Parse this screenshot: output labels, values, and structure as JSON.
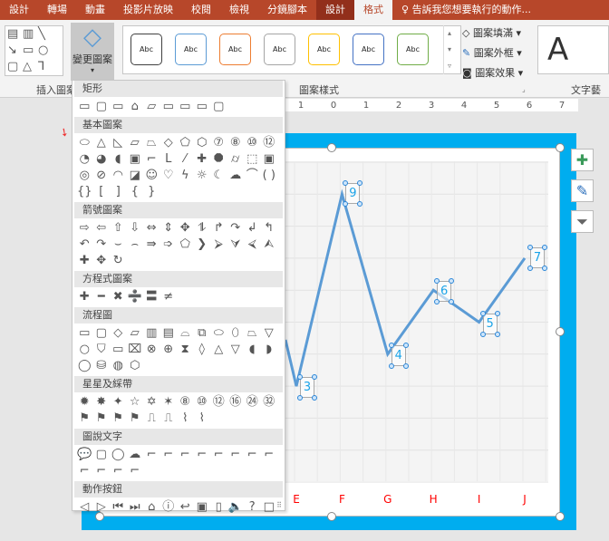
{
  "tabs": [
    "設計",
    "轉場",
    "動畫",
    "投影片放映",
    "校閱",
    "檢視",
    "分鏡腳本",
    "設計",
    "格式"
  ],
  "active_tab": "格式",
  "tell_me": "告訴我您想要執行的動作...",
  "ribbon": {
    "insert_shapes_label": "插入圖案",
    "insert_icons": [
      "▤",
      "▥",
      "╲",
      "↘",
      "▭",
      "○",
      "▢",
      "△",
      "⅂",
      "▾",
      "▿"
    ],
    "change_shape_label": "變更圖案",
    "styles_label": "圖案樣式",
    "gallery": [
      {
        "text": "Abc",
        "color": "#404040"
      },
      {
        "text": "Abc",
        "color": "#5b9bd5"
      },
      {
        "text": "Abc",
        "color": "#ed7d31"
      },
      {
        "text": "Abc",
        "color": "#a5a5a5"
      },
      {
        "text": "Abc",
        "color": "#ffc000"
      },
      {
        "text": "Abc",
        "color": "#4472c4"
      },
      {
        "text": "Abc",
        "color": "#70ad47"
      }
    ],
    "shape_fill": "圖案填滿",
    "shape_outline": "圖案外框",
    "shape_effects": "圖案效果",
    "wordart_label": "文字藝",
    "wordart_sample": "A"
  },
  "ruler": [
    "1",
    "0",
    "1",
    "2",
    "3",
    "4",
    "5",
    "6",
    "7"
  ],
  "dropdown": {
    "sections": [
      {
        "title": "矩形",
        "icons": [
          "▭",
          "▢",
          "▭",
          "⌂",
          "▱",
          "▭",
          "▭",
          "▭",
          "▢"
        ]
      },
      {
        "title": "基本圖案",
        "icons": [
          "⬭",
          "△",
          "◺",
          "▱",
          "⏢",
          "◇",
          "⬠",
          "⬡",
          "⑦",
          "⑧",
          "⑩",
          "⑫",
          "◔",
          "◕",
          "◖",
          "▣",
          "⌐",
          "L",
          "⁄",
          "✚",
          "⯃",
          "⌭",
          "⬚",
          "▣",
          "◎",
          "⊘",
          "◠",
          "◪",
          "☺",
          "♡",
          "ϟ",
          "☼",
          "☾",
          "☁",
          "⌒",
          "( )",
          "{}",
          "[",
          "]",
          "{",
          "}"
        ]
      },
      {
        "title": "箭號圖案",
        "icons": [
          "⇨",
          "⇦",
          "⇧",
          "⇩",
          "⇔",
          "⇕",
          "✥",
          "⥮",
          "↱",
          "↷",
          "↲",
          "↰",
          "↶",
          "↷",
          "⌣",
          "⌢",
          "⇛",
          "➩",
          "⬠",
          "❯",
          "⮚",
          "⮛",
          "⮘",
          "⮙",
          "✚",
          "✥",
          "↻"
        ]
      },
      {
        "title": "方程式圖案",
        "icons": [
          "✚",
          "━",
          "✖",
          "➗",
          "〓",
          "≠"
        ]
      },
      {
        "title": "流程圖",
        "icons": [
          "▭",
          "▢",
          "◇",
          "▱",
          "▥",
          "▤",
          "⌓",
          "⧉",
          "⬭",
          "⬯",
          "⏢",
          "▽",
          "○",
          "⛉",
          "▭",
          "⌧",
          "⊗",
          "⊕",
          "⧗",
          "◊",
          "△",
          "▽",
          "◖",
          "◗",
          "◯",
          "⛁",
          "◍",
          "⬡"
        ]
      },
      {
        "title": "星星及綵帶",
        "icons": [
          "✹",
          "✸",
          "✦",
          "☆",
          "✡",
          "✶",
          "⑧",
          "⑩",
          "⑫",
          "⑯",
          "㉔",
          "㉜",
          "⚑",
          "⚑",
          "⚑",
          "⚑",
          "⎍",
          "⎍",
          "⌇",
          "⌇"
        ]
      },
      {
        "title": "圖說文字",
        "icons": [
          "💬",
          "▢",
          "◯",
          "☁",
          "⌐",
          "⌐",
          "⌐",
          "⌐",
          "⌐",
          "⌐",
          "⌐",
          "⌐",
          "⌐",
          "⌐",
          "⌐",
          "⌐"
        ]
      },
      {
        "title": "動作按鈕",
        "icons": [
          "◁",
          "▷",
          "⏮",
          "⏭",
          "⌂",
          "ⓘ",
          "↩",
          "▣",
          "▯",
          "🔈",
          "?",
          "□"
        ]
      }
    ]
  },
  "chart_data": {
    "type": "line",
    "categories": [
      "E",
      "F",
      "G",
      "H",
      "I",
      "J"
    ],
    "values": [
      3,
      9,
      4,
      6,
      5,
      7
    ],
    "data_labels": [
      "3",
      "9",
      "4",
      "6",
      "5",
      "7"
    ],
    "line_color": "#5b9bd5",
    "category_label_color": "#ff0000",
    "grid": true
  },
  "side_buttons": [
    "chart-elements",
    "chart-styles",
    "chart-filters"
  ]
}
